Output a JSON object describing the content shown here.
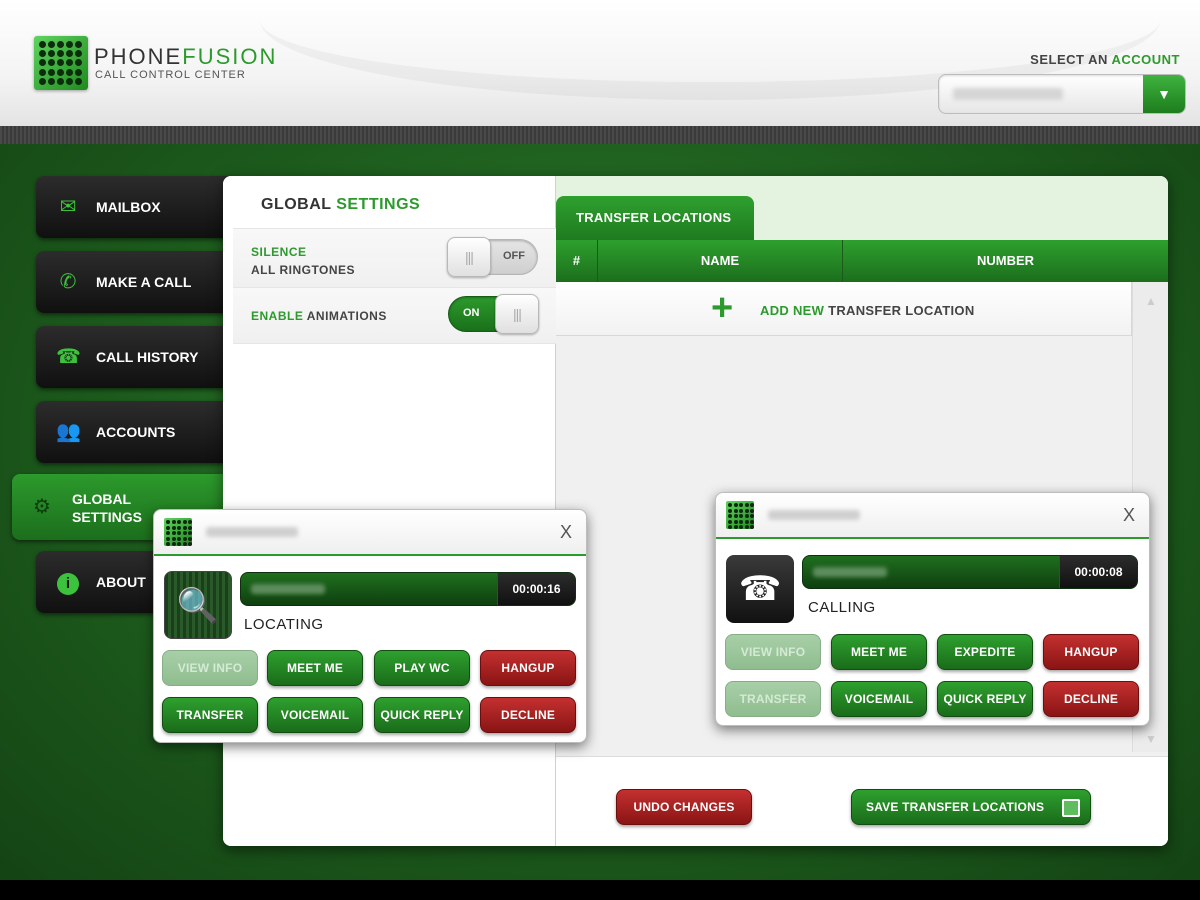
{
  "header": {
    "brand_part1": "PHONE",
    "brand_part2": "FUSION",
    "brand_subtitle": "CALL CONTROL CENTER",
    "select_label_part1": "SELECT AN ",
    "select_label_part2": "ACCOUNT",
    "account_icon": "chevron-down-icon"
  },
  "sidebar": {
    "items": [
      {
        "label": "MAILBOX",
        "icon": "mail-icon"
      },
      {
        "label": "MAKE A CALL",
        "icon": "phone-icon"
      },
      {
        "label": "CALL HISTORY",
        "icon": "telephone-icon"
      },
      {
        "label": "ACCOUNTS",
        "icon": "users-icon"
      },
      {
        "label_line1": "GLOBAL",
        "label_line2": "SETTINGS",
        "icon": "gear-icon",
        "active": true
      },
      {
        "label": "ABOUT",
        "icon": "info-icon"
      }
    ]
  },
  "settings": {
    "title_part1": "GLOBAL ",
    "title_part2": "SETTINGS",
    "rows": [
      {
        "label_part1": "SILENCE",
        "label_part2": "ALL RINGTONES",
        "toggle": "OFF"
      },
      {
        "label_part1": "ENABLE",
        "label_part2": " ANIMATIONS",
        "toggle": "ON"
      }
    ]
  },
  "transfer": {
    "tab_label": "TRANSFER LOCATIONS",
    "columns": [
      "#",
      "NAME",
      "NUMBER"
    ],
    "add_part1": "ADD NEW",
    "add_part2": " TRANSFER LOCATION",
    "undo_label": "UNDO CHANGES",
    "save_label": "SAVE TRANSFER LOCATIONS"
  },
  "calls": [
    {
      "status": "LOCATING",
      "timer": "00:00:16",
      "buttons_row1": [
        "VIEW INFO",
        "MEET ME",
        "PLAY WC",
        "HANGUP"
      ],
      "buttons_row2": [
        "TRANSFER",
        "VOICEMAIL",
        "QUICK REPLY",
        "DECLINE"
      ]
    },
    {
      "status": "CALLING",
      "timer": "00:00:08",
      "buttons_row1": [
        "VIEW INFO",
        "MEET ME",
        "EXPEDITE",
        "HANGUP"
      ],
      "buttons_row2": [
        "TRANSFER",
        "VOICEMAIL",
        "QUICK REPLY",
        "DECLINE"
      ]
    }
  ],
  "colors": {
    "brand_green": "#2c9a2c",
    "danger_red": "#a82020",
    "nav_dark": "#1a1a1a"
  }
}
